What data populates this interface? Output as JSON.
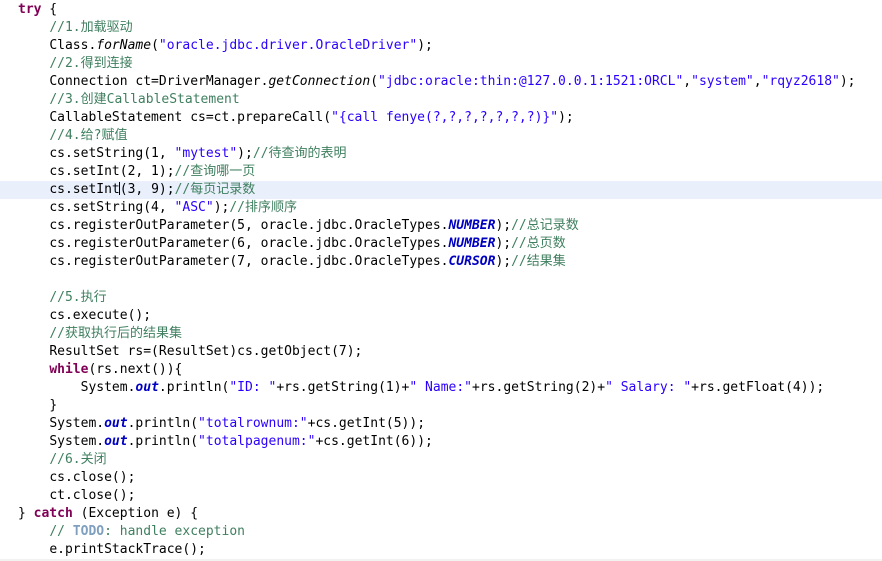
{
  "editor": {
    "language": "java",
    "highlighted_line_index": 9,
    "colors": {
      "background": "#ffffff",
      "foreground": "#000000",
      "keyword": "#7f0055",
      "string": "#2a00ff",
      "comment": "#3f7f5f",
      "todo_tag": "#7f9fbf",
      "static_field": "#0000c0",
      "constant": "#0000c0",
      "current_line_highlight": "#e9effb"
    },
    "lines": [
      {
        "index": 0,
        "indent": 0,
        "plain_text": "try {",
        "tokens": [
          {
            "t": "try",
            "c": "kw"
          },
          {
            "t": " {",
            "c": "plain"
          }
        ]
      },
      {
        "index": 1,
        "indent": 1,
        "plain_text": "//1.加载驱动",
        "tokens": [
          {
            "t": "//1.加载驱动",
            "c": "cmt"
          }
        ]
      },
      {
        "index": 2,
        "indent": 1,
        "plain_text": "Class.forName(\"oracle.jdbc.driver.OracleDriver\");",
        "tokens": [
          {
            "t": "Class.",
            "c": "plain"
          },
          {
            "t": "forName",
            "c": "mth"
          },
          {
            "t": "(",
            "c": "plain"
          },
          {
            "t": "\"oracle.jdbc.driver.OracleDriver\"",
            "c": "str"
          },
          {
            "t": ");",
            "c": "plain"
          }
        ]
      },
      {
        "index": 3,
        "indent": 1,
        "plain_text": "//2.得到连接",
        "tokens": [
          {
            "t": "//2.得到连接",
            "c": "cmt"
          }
        ]
      },
      {
        "index": 4,
        "indent": 1,
        "plain_text": "Connection ct=DriverManager.getConnection(\"jdbc:oracle:thin:@127.0.0.1:1521:ORCL\",\"system\",\"rqyz2618\");",
        "tokens": [
          {
            "t": "Connection ct=DriverManager.",
            "c": "plain"
          },
          {
            "t": "getConnection",
            "c": "mth"
          },
          {
            "t": "(",
            "c": "plain"
          },
          {
            "t": "\"jdbc:oracle:thin:@127.0.0.1:1521:ORCL\"",
            "c": "str"
          },
          {
            "t": ",",
            "c": "plain"
          },
          {
            "t": "\"system\"",
            "c": "str"
          },
          {
            "t": ",",
            "c": "plain"
          },
          {
            "t": "\"rqyz2618\"",
            "c": "str"
          },
          {
            "t": ");",
            "c": "plain"
          }
        ]
      },
      {
        "index": 5,
        "indent": 1,
        "plain_text": "//3.创建CallableStatement",
        "tokens": [
          {
            "t": "//3.创建CallableStatement",
            "c": "cmt"
          }
        ]
      },
      {
        "index": 6,
        "indent": 1,
        "plain_text": "CallableStatement cs=ct.prepareCall(\"{call fenye(?,?,?,?,?,?,?)}\");",
        "tokens": [
          {
            "t": "CallableStatement cs=ct.prepareCall(",
            "c": "plain"
          },
          {
            "t": "\"{call fenye(?,?,?,?,?,?,?)}\"",
            "c": "str"
          },
          {
            "t": ");",
            "c": "plain"
          }
        ]
      },
      {
        "index": 7,
        "indent": 1,
        "plain_text": "//4.给?赋值",
        "tokens": [
          {
            "t": "//4.给?赋值",
            "c": "cmt"
          }
        ]
      },
      {
        "index": 8,
        "indent": 1,
        "plain_text": "cs.setString(1, \"mytest\");//待查询的表明",
        "tokens": [
          {
            "t": "cs.setString(1, ",
            "c": "plain"
          },
          {
            "t": "\"mytest\"",
            "c": "str"
          },
          {
            "t": ");",
            "c": "plain"
          },
          {
            "t": "//待查询的表明",
            "c": "cmt"
          }
        ]
      },
      {
        "index": 9,
        "indent": 1,
        "plain_text": "cs.setInt(2, 1);//查询哪一页",
        "tokens": [
          {
            "t": "cs.setInt(2, 1);",
            "c": "plain"
          },
          {
            "t": "//查询哪一页",
            "c": "cmt"
          }
        ]
      },
      {
        "index": 10,
        "indent": 1,
        "highlighted": true,
        "caret_after": "cs.setInt",
        "plain_text": "cs.setInt(3, 9);//每页记录数",
        "tokens": [
          {
            "t": "cs.setInt",
            "c": "plain"
          },
          {
            "t": "(3, 9);",
            "c": "plain"
          },
          {
            "t": "//每页记录数",
            "c": "cmt"
          }
        ]
      },
      {
        "index": 11,
        "indent": 1,
        "plain_text": "cs.setString(4, \"ASC\");//排序顺序",
        "tokens": [
          {
            "t": "cs.setString(4, ",
            "c": "plain"
          },
          {
            "t": "\"ASC\"",
            "c": "str"
          },
          {
            "t": ");",
            "c": "plain"
          },
          {
            "t": "//排序顺序",
            "c": "cmt"
          }
        ]
      },
      {
        "index": 12,
        "indent": 1,
        "plain_text": "cs.registerOutParameter(5, oracle.jdbc.OracleTypes.NUMBER);//总记录数",
        "tokens": [
          {
            "t": "cs.registerOutParameter(5, oracle.jdbc.OracleTypes.",
            "c": "plain"
          },
          {
            "t": "NUMBER",
            "c": "cst"
          },
          {
            "t": ");",
            "c": "plain"
          },
          {
            "t": "//总记录数",
            "c": "cmt"
          }
        ]
      },
      {
        "index": 13,
        "indent": 1,
        "plain_text": "cs.registerOutParameter(6, oracle.jdbc.OracleTypes.NUMBER);//总页数",
        "tokens": [
          {
            "t": "cs.registerOutParameter(6, oracle.jdbc.OracleTypes.",
            "c": "plain"
          },
          {
            "t": "NUMBER",
            "c": "cst"
          },
          {
            "t": ");",
            "c": "plain"
          },
          {
            "t": "//总页数",
            "c": "cmt"
          }
        ]
      },
      {
        "index": 14,
        "indent": 1,
        "plain_text": "cs.registerOutParameter(7, oracle.jdbc.OracleTypes.CURSOR);//结果集",
        "tokens": [
          {
            "t": "cs.registerOutParameter(7, oracle.jdbc.OracleTypes.",
            "c": "plain"
          },
          {
            "t": "CURSOR",
            "c": "cst"
          },
          {
            "t": ");",
            "c": "plain"
          },
          {
            "t": "//结果集",
            "c": "cmt"
          }
        ]
      },
      {
        "index": 15,
        "indent": 0,
        "blank": true,
        "plain_text": "",
        "tokens": []
      },
      {
        "index": 16,
        "indent": 1,
        "plain_text": "//5.执行",
        "tokens": [
          {
            "t": "//5.执行",
            "c": "cmt"
          }
        ]
      },
      {
        "index": 17,
        "indent": 1,
        "plain_text": "cs.execute();",
        "tokens": [
          {
            "t": "cs.execute();",
            "c": "plain"
          }
        ]
      },
      {
        "index": 18,
        "indent": 1,
        "plain_text": "//获取执行后的结果集",
        "tokens": [
          {
            "t": "//获取执行后的结果集",
            "c": "cmt"
          }
        ]
      },
      {
        "index": 19,
        "indent": 1,
        "plain_text": "ResultSet rs=(ResultSet)cs.getObject(7);",
        "tokens": [
          {
            "t": "ResultSet rs=(ResultSet)cs.getObject(7);",
            "c": "plain"
          }
        ]
      },
      {
        "index": 20,
        "indent": 1,
        "plain_text": "while(rs.next()){",
        "tokens": [
          {
            "t": "while",
            "c": "kw"
          },
          {
            "t": "(rs.next()){",
            "c": "plain"
          }
        ]
      },
      {
        "index": 21,
        "indent": 2,
        "plain_text": "System.out.println(\"ID: \"+rs.getString(1)+\" Name:\"+rs.getString(2)+\" Salary: \"+rs.getFloat(4));",
        "tokens": [
          {
            "t": "System.",
            "c": "plain"
          },
          {
            "t": "out",
            "c": "cst"
          },
          {
            "t": ".println(",
            "c": "plain"
          },
          {
            "t": "\"ID: \"",
            "c": "str"
          },
          {
            "t": "+rs.getString(1)+",
            "c": "plain"
          },
          {
            "t": "\" Name:\"",
            "c": "str"
          },
          {
            "t": "+rs.getString(2)+",
            "c": "plain"
          },
          {
            "t": "\" Salary: \"",
            "c": "str"
          },
          {
            "t": "+rs.getFloat(4));",
            "c": "plain"
          }
        ]
      },
      {
        "index": 22,
        "indent": 1,
        "plain_text": "}",
        "tokens": [
          {
            "t": "}",
            "c": "plain"
          }
        ]
      },
      {
        "index": 23,
        "indent": 1,
        "plain_text": "System.out.println(\"totalrownum:\"+cs.getInt(5));",
        "tokens": [
          {
            "t": "System.",
            "c": "plain"
          },
          {
            "t": "out",
            "c": "cst"
          },
          {
            "t": ".println(",
            "c": "plain"
          },
          {
            "t": "\"totalrownum:\"",
            "c": "str"
          },
          {
            "t": "+cs.getInt(5));",
            "c": "plain"
          }
        ]
      },
      {
        "index": 24,
        "indent": 1,
        "plain_text": "System.out.println(\"totalpagenum:\"+cs.getInt(6));",
        "tokens": [
          {
            "t": "System.",
            "c": "plain"
          },
          {
            "t": "out",
            "c": "cst"
          },
          {
            "t": ".println(",
            "c": "plain"
          },
          {
            "t": "\"totalpagenum:\"",
            "c": "str"
          },
          {
            "t": "+cs.getInt(6));",
            "c": "plain"
          }
        ]
      },
      {
        "index": 25,
        "indent": 1,
        "plain_text": "//6.关闭",
        "tokens": [
          {
            "t": "//6.关闭",
            "c": "cmt"
          }
        ]
      },
      {
        "index": 26,
        "indent": 1,
        "plain_text": "cs.close();",
        "tokens": [
          {
            "t": "cs.close();",
            "c": "plain"
          }
        ]
      },
      {
        "index": 27,
        "indent": 1,
        "plain_text": "ct.close();",
        "tokens": [
          {
            "t": "ct.close();",
            "c": "plain"
          }
        ]
      },
      {
        "index": 28,
        "indent": 0,
        "plain_text": "} catch (Exception e) {",
        "tokens": [
          {
            "t": "} ",
            "c": "plain"
          },
          {
            "t": "catch",
            "c": "kw"
          },
          {
            "t": " (Exception e) {",
            "c": "plain"
          }
        ]
      },
      {
        "index": 29,
        "indent": 1,
        "plain_text": "// TODO: handle exception",
        "tokens": [
          {
            "t": "// ",
            "c": "cmt"
          },
          {
            "t": "TODO",
            "c": "todo"
          },
          {
            "t": ": handle exception",
            "c": "cmt"
          }
        ]
      },
      {
        "index": 30,
        "indent": 1,
        "plain_text": "e.printStackTrace();",
        "tokens": [
          {
            "t": "e.printStackTrace();",
            "c": "plain"
          }
        ]
      }
    ]
  }
}
